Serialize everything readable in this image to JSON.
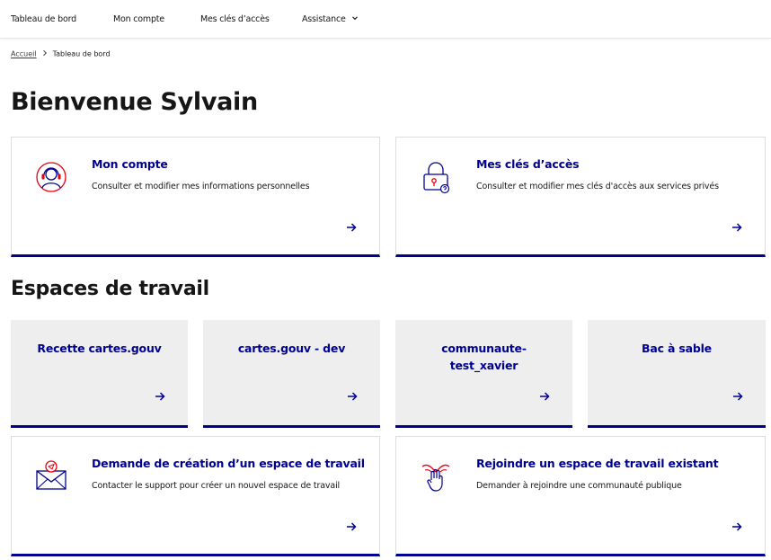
{
  "nav": {
    "items": [
      {
        "label": "Tableau de bord"
      },
      {
        "label": "Mon compte"
      },
      {
        "label": "Mes clés d’accès"
      },
      {
        "label": "Assistance"
      }
    ]
  },
  "breadcrumb": {
    "home": "Accueil",
    "current": "Tableau de bord"
  },
  "page": {
    "title": "Bienvenue Sylvain",
    "workspaces_title": "Espaces de travail"
  },
  "tiles": {
    "account": {
      "title": "Mon compte",
      "desc": "Consulter et modifier mes informations personnelles"
    },
    "keys": {
      "title": "Mes clés d’accès",
      "desc": "Consulter et modifier mes clés d'accès aux services privés"
    },
    "create": {
      "title": "Demande de création d’un espace de travail",
      "desc": "Contacter le support pour créer un nouvel espace de travail"
    },
    "join": {
      "title": "Rejoindre un espace de travail existant",
      "desc": "Demander à rejoindre une communauté publique"
    }
  },
  "workspaces": [
    {
      "title": "Recette cartes.gouv"
    },
    {
      "title": "cartes.gouv - dev"
    },
    {
      "title": "communaute-test_xavier"
    },
    {
      "title": "Bac à sable"
    }
  ],
  "colors": {
    "primary": "#000091",
    "accent_red": "#e1000f",
    "tile_grey": "#eeeeee",
    "text": "#161616"
  },
  "icons": {
    "arrow": "arrow-right-icon",
    "chevron": "chevron-down-icon",
    "breadcrumb_sep": "chevron-right-icon",
    "account": "support-avatar-icon",
    "keys": "padlock-icon",
    "create": "mail-send-icon",
    "join": "hands-together-icon"
  }
}
